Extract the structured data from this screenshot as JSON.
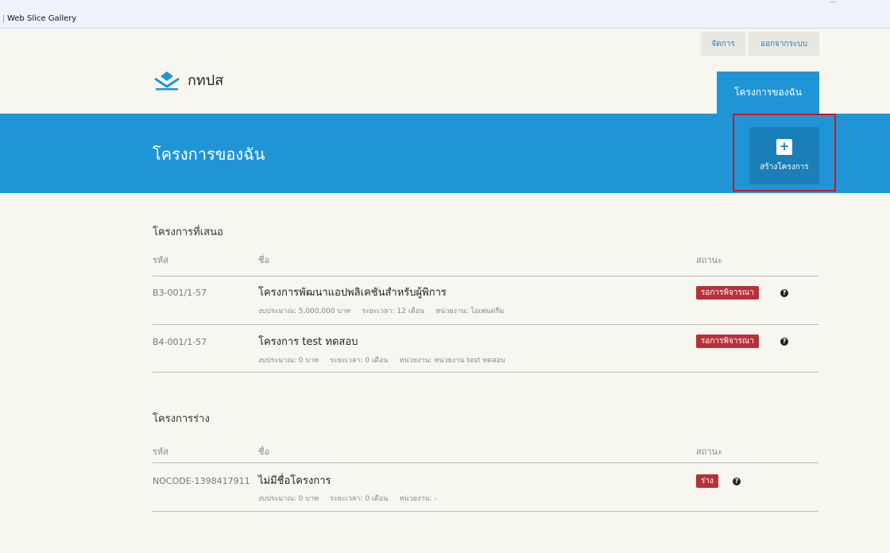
{
  "favorites": {
    "item_label": "Web Slice Gallery"
  },
  "header": {
    "manage_label": "จัดการ",
    "logout_label": "ออกจากระบบ",
    "logo_text": "กทปส",
    "tab_my_projects": "โครงการของฉัน"
  },
  "banner": {
    "title": "โครงการของฉัน",
    "create_label": "สร้างโครงการ"
  },
  "proposed": {
    "title": "โครงการที่เสนอ",
    "columns": {
      "code": "รหัส",
      "name": "ชื่อ",
      "status": "สถานะ"
    },
    "rows": [
      {
        "code": "B3-001/1-57",
        "name": "โครงการพัฒนาแอปพลิเคชันสำหรับผู้พิการ",
        "budget": "งบประมาณ: 5,000,000 บาท",
        "duration": "ระยะเวลา: 12 เดือน",
        "agency": "หน่วยงาน: โอเพ่นดรีม",
        "status": "รอการพิจารณา"
      },
      {
        "code": "B4-001/1-57",
        "name": "โครงการ test ทดสอบ",
        "budget": "งบประมาณ: 0 บาท",
        "duration": "ระยะเวลา: 0 เดือน",
        "agency": "หน่วยงาน: หน่วยงาน test ทดสอบ",
        "status": "รอการพิจารณา"
      }
    ]
  },
  "drafts": {
    "title": "โครงการร่าง",
    "columns": {
      "code": "รหัส",
      "name": "ชื่อ",
      "status": "สถานะ"
    },
    "rows": [
      {
        "code": "NOCODE-1398417911",
        "name": "ไม่มีชื่อโครงการ",
        "budget": "งบประมาณ: 0 บาท",
        "duration": "ระยะเวลา: 0 เดือน",
        "agency": "หน่วยงาน: -",
        "status": "ร่าง"
      }
    ]
  },
  "colors": {
    "primary": "#1f95d6",
    "badge": "#b7313a",
    "highlight": "#d6121b"
  }
}
